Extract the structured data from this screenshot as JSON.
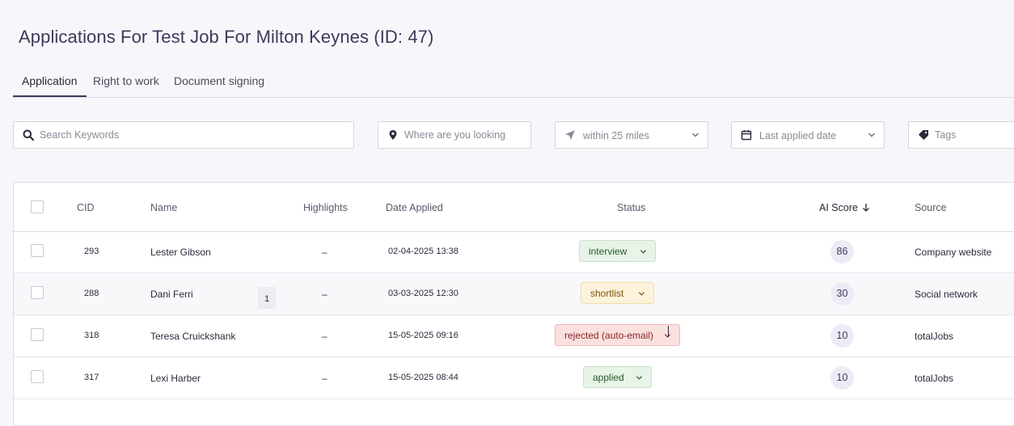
{
  "page": {
    "title": "Applications For Test Job For Milton Keynes (ID: 47)"
  },
  "tabs": [
    {
      "label": "Application",
      "active": true
    },
    {
      "label": "Right to work",
      "active": false
    },
    {
      "label": "Document signing",
      "active": false
    }
  ],
  "filters": {
    "search": {
      "placeholder": "Search Keywords",
      "icon": "search-icon"
    },
    "location": {
      "placeholder": "Where are you looking ?",
      "icon": "map-pin-icon"
    },
    "radius": {
      "value": "within 25 miles",
      "icon": "navigation-arrow-icon"
    },
    "date": {
      "value": "Last applied date",
      "icon": "calendar-icon"
    },
    "tags": {
      "placeholder": "Tags",
      "icon": "tag-icon"
    }
  },
  "table": {
    "columns": {
      "cid": "CID",
      "name": "Name",
      "highlights": "Highlights",
      "date_applied": "Date Applied",
      "status": "Status",
      "ai_score": "AI Score",
      "source": "Source"
    },
    "sort": {
      "column": "AI Score",
      "direction": "descending"
    },
    "rows": [
      {
        "cid": "293",
        "name": "Lester Gibson",
        "highlights": "–",
        "date": "02-04-2025 13:38",
        "status": "interview",
        "score": "86",
        "source": "Company website"
      },
      {
        "cid": "288",
        "name": "Dani Ferri",
        "badge": "1",
        "highlights": "–",
        "date": "03-03-2025 12:30",
        "status": "shortlist",
        "score": "30",
        "source": "Social network"
      },
      {
        "cid": "318",
        "name": "Teresa Cruickshank",
        "highlights": "–",
        "date": "15-05-2025 09:16",
        "status": "rejected (auto-email)",
        "score": "10",
        "source": "totalJobs"
      },
      {
        "cid": "317",
        "name": "Lexi Harber",
        "highlights": "–",
        "date": "15-05-2025 08:44",
        "status": "applied",
        "score": "10",
        "source": "totalJobs"
      }
    ]
  },
  "colors": {
    "status_green": "#e8f4e8",
    "status_yellow": "#fdf3dc",
    "status_red": "#fbe0e0",
    "score_bg": "#ececf7",
    "title": "#3d3a5c"
  }
}
